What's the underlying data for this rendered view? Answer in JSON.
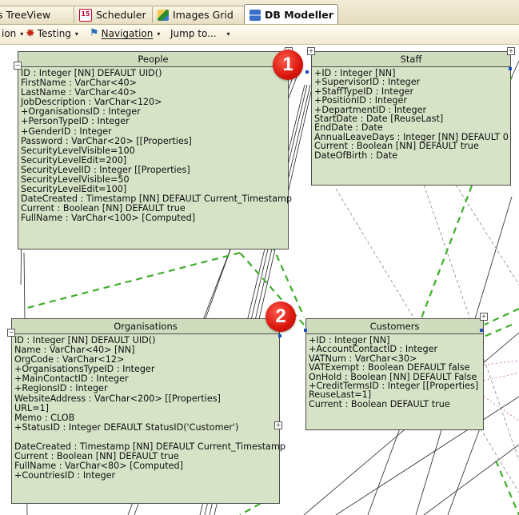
{
  "tabs": [
    {
      "label": "s TreeView",
      "icon": "treeview-icon",
      "active": false
    },
    {
      "label": "Scheduler",
      "icon": "calendar-icon",
      "icon_text": "15",
      "active": false
    },
    {
      "label": "Images Grid",
      "icon": "images-icon",
      "active": false
    },
    {
      "label": "DB Modeller",
      "icon": "db-modeller-icon",
      "active": true
    }
  ],
  "toolbar": {
    "item0": "ion",
    "testing": "Testing",
    "navigation": "Navigation",
    "jump": "Jump to...",
    "caret": "▾"
  },
  "entities": {
    "people": {
      "title": "People",
      "fields": [
        "ID : Integer [NN] DEFAULT UID()",
        "FirstName : VarChar<40>",
        "LastName : VarChar<40>",
        "JobDescription : VarChar<120>",
        "+OrganisationsID : Integer",
        "+PersonTypeID : Integer",
        "+GenderID : Integer",
        "Password : VarChar<20> [[Properties]",
        "SecurityLevelVisible=100",
        "SecurityLevelEdit=200]",
        "SecurityLevelID : Integer [[Properties]",
        "SecurityLevelVisible=50",
        "SecurityLevelEdit=100]",
        "DateCreated : Timestamp [NN] DEFAULT Current_Timestamp",
        "Current : Boolean [NN] DEFAULT true",
        "FullName : VarChar<100> [Computed]"
      ]
    },
    "staff": {
      "title": "Staff",
      "fields": [
        "+ID : Integer [NN]",
        "+SupervisorID : Integer",
        "+StaffTypeID : Integer",
        "+PositionID : Integer",
        "+DepartmentID : Integer",
        "StartDate : Date [ReuseLast]",
        "EndDate : Date",
        "AnnualLeaveDays : Integer [NN] DEFAULT 0",
        "Current : Boolean [NN] DEFAULT true",
        "DateOfBirth : Date"
      ]
    },
    "organisations": {
      "title": "Organisations",
      "fields": [
        "ID : Integer [NN] DEFAULT UID()",
        "Name : VarChar<40> [NN]",
        "OrgCode : VarChar<12>",
        "+OrganisationsTypeID : Integer",
        "+MainContactID : Integer",
        "+RegionsID : Integer",
        "WebsiteAddress : VarChar<200> [[Properties]",
        "URL=1]",
        "Memo : CLOB",
        "+StatusID : Integer DEFAULT StatusID('Customer')",
        "",
        "DateCreated : Timestamp [NN] DEFAULT Current_Timestamp",
        "Current : Boolean [NN] DEFAULT true",
        "FullName : VarChar<80> [Computed]",
        "+CountriesID : Integer"
      ]
    },
    "customers": {
      "title": "Customers",
      "fields": [
        "+ID : Integer [NN]",
        "+AccountContactID : Integer",
        "VATNum : VarChar<30>",
        "VATExempt : Boolean DEFAULT false",
        "OnHold : Boolean [NN] DEFAULT False",
        "+CreditTermsID : Integer [[Properties]",
        "ReuseLast=1]",
        "Current : Boolean DEFAULT true"
      ]
    }
  },
  "badges": [
    "1",
    "2"
  ],
  "colors": {
    "entity_fill": "#d6e3c6",
    "relation_dashed": "#3fae2a",
    "badge": "#d8150c",
    "connector": "#1f4fbf"
  }
}
